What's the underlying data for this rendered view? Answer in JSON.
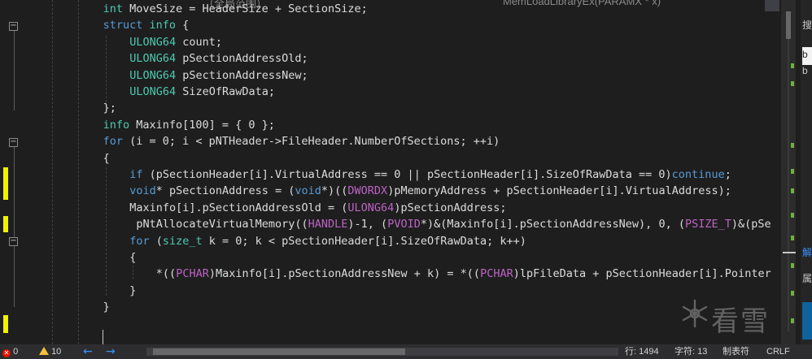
{
  "top_tabs": {
    "left_fragment": "（全局范围）",
    "right_fragment": "MemLoadLibraryEx(PARAMX * x)",
    "chevron": "▾"
  },
  "code_lines": [
    {
      "indent": 4,
      "tokens": [
        [
          "ty",
          "int"
        ],
        [
          "pl",
          " MoveSize = HeaderSize + SectionSize;"
        ]
      ]
    },
    {
      "indent": 4,
      "tokens": [
        [
          "kw",
          "struct"
        ],
        [
          "pl",
          " "
        ],
        [
          "ty",
          "info"
        ],
        [
          "pl",
          " {"
        ]
      ]
    },
    {
      "indent": 8,
      "tokens": [
        [
          "ty",
          "ULONG64"
        ],
        [
          "pl",
          " count;"
        ]
      ]
    },
    {
      "indent": 8,
      "tokens": [
        [
          "ty",
          "ULONG64"
        ],
        [
          "pl",
          " pSectionAddressOld;"
        ]
      ]
    },
    {
      "indent": 8,
      "tokens": [
        [
          "ty",
          "ULONG64"
        ],
        [
          "pl",
          " pSectionAddressNew;"
        ]
      ]
    },
    {
      "indent": 8,
      "tokens": [
        [
          "ty",
          "ULONG64"
        ],
        [
          "pl",
          " SizeOfRawData;"
        ]
      ]
    },
    {
      "indent": 4,
      "tokens": [
        [
          "pl",
          "};"
        ]
      ]
    },
    {
      "indent": 4,
      "tokens": [
        [
          "ty",
          "info"
        ],
        [
          "pl",
          " Maxinfo[100] = { 0 };"
        ]
      ]
    },
    {
      "indent": 4,
      "tokens": [
        [
          "kw",
          "for"
        ],
        [
          "pl",
          " (i = 0; i < pNTHeader->FileHeader.NumberOfSections; ++i)"
        ]
      ]
    },
    {
      "indent": 4,
      "tokens": [
        [
          "pl",
          "{"
        ]
      ]
    },
    {
      "indent": 8,
      "tokens": [
        [
          "kw",
          "if"
        ],
        [
          "pl",
          " (pSectionHeader[i].VirtualAddress == 0 || pSectionHeader[i].SizeOfRawData == 0)"
        ],
        [
          "kw",
          "continue"
        ],
        [
          "pl",
          ";"
        ]
      ]
    },
    {
      "indent": 8,
      "tokens": [
        [
          "kw",
          "void"
        ],
        [
          "pl",
          "* pSectionAddress = ("
        ],
        [
          "kw",
          "void"
        ],
        [
          "pl",
          "*)(("
        ],
        [
          "mac",
          "DWORDX"
        ],
        [
          "pl",
          ")pMemoryAddress + pSectionHeader[i].VirtualAddress);"
        ]
      ]
    },
    {
      "indent": 8,
      "tokens": [
        [
          "pl",
          "Maxinfo[i].pSectionAddressOld = ("
        ],
        [
          "mac",
          "ULONG64"
        ],
        [
          "pl",
          ")pSectionAddress;"
        ]
      ]
    },
    {
      "indent": 8,
      "tokens": [
        [
          "pl",
          " pNtAllocateVirtualMemory(("
        ],
        [
          "mac",
          "HANDLE"
        ],
        [
          "pl",
          ")-1, ("
        ],
        [
          "mac",
          "PVOID"
        ],
        [
          "pl",
          "*)&(Maxinfo[i].pSectionAddressNew), 0, ("
        ],
        [
          "mac",
          "PSIZE_T"
        ],
        [
          "pl",
          ")&(pSe"
        ]
      ]
    },
    {
      "indent": 8,
      "tokens": [
        [
          "kw",
          "for"
        ],
        [
          "pl",
          " ("
        ],
        [
          "ty",
          "size_t"
        ],
        [
          "pl",
          " k = 0; k < pSectionHeader[i].SizeOfRawData; k++)"
        ]
      ]
    },
    {
      "indent": 8,
      "tokens": [
        [
          "pl",
          "{"
        ]
      ]
    },
    {
      "indent": 12,
      "tokens": [
        [
          "pl",
          "*(("
        ],
        [
          "mac",
          "PCHAR"
        ],
        [
          "pl",
          ")Maxinfo[i].pSectionAddressNew + k) = *(("
        ],
        [
          "mac",
          "PCHAR"
        ],
        [
          "pl",
          ")lpFileData + pSectionHeader[i].Pointer"
        ]
      ]
    },
    {
      "indent": 8,
      "tokens": [
        [
          "pl",
          "}"
        ]
      ]
    },
    {
      "indent": 4,
      "tokens": [
        [
          "pl",
          "}"
        ]
      ]
    },
    {
      "indent": 0,
      "tokens": [
        [
          "pl",
          ""
        ]
      ]
    }
  ],
  "right_panel": {
    "chars": [
      "搜",
      "b",
      "b",
      "解",
      "属"
    ]
  },
  "watermark": {
    "text": "看雪"
  },
  "status_bar": {
    "errors": "0",
    "warnings": "10",
    "line": "行: 1494",
    "col": "字符: 13",
    "tab_mode": "制表符",
    "eol": "CRLF",
    "error_glyph": "✕"
  }
}
